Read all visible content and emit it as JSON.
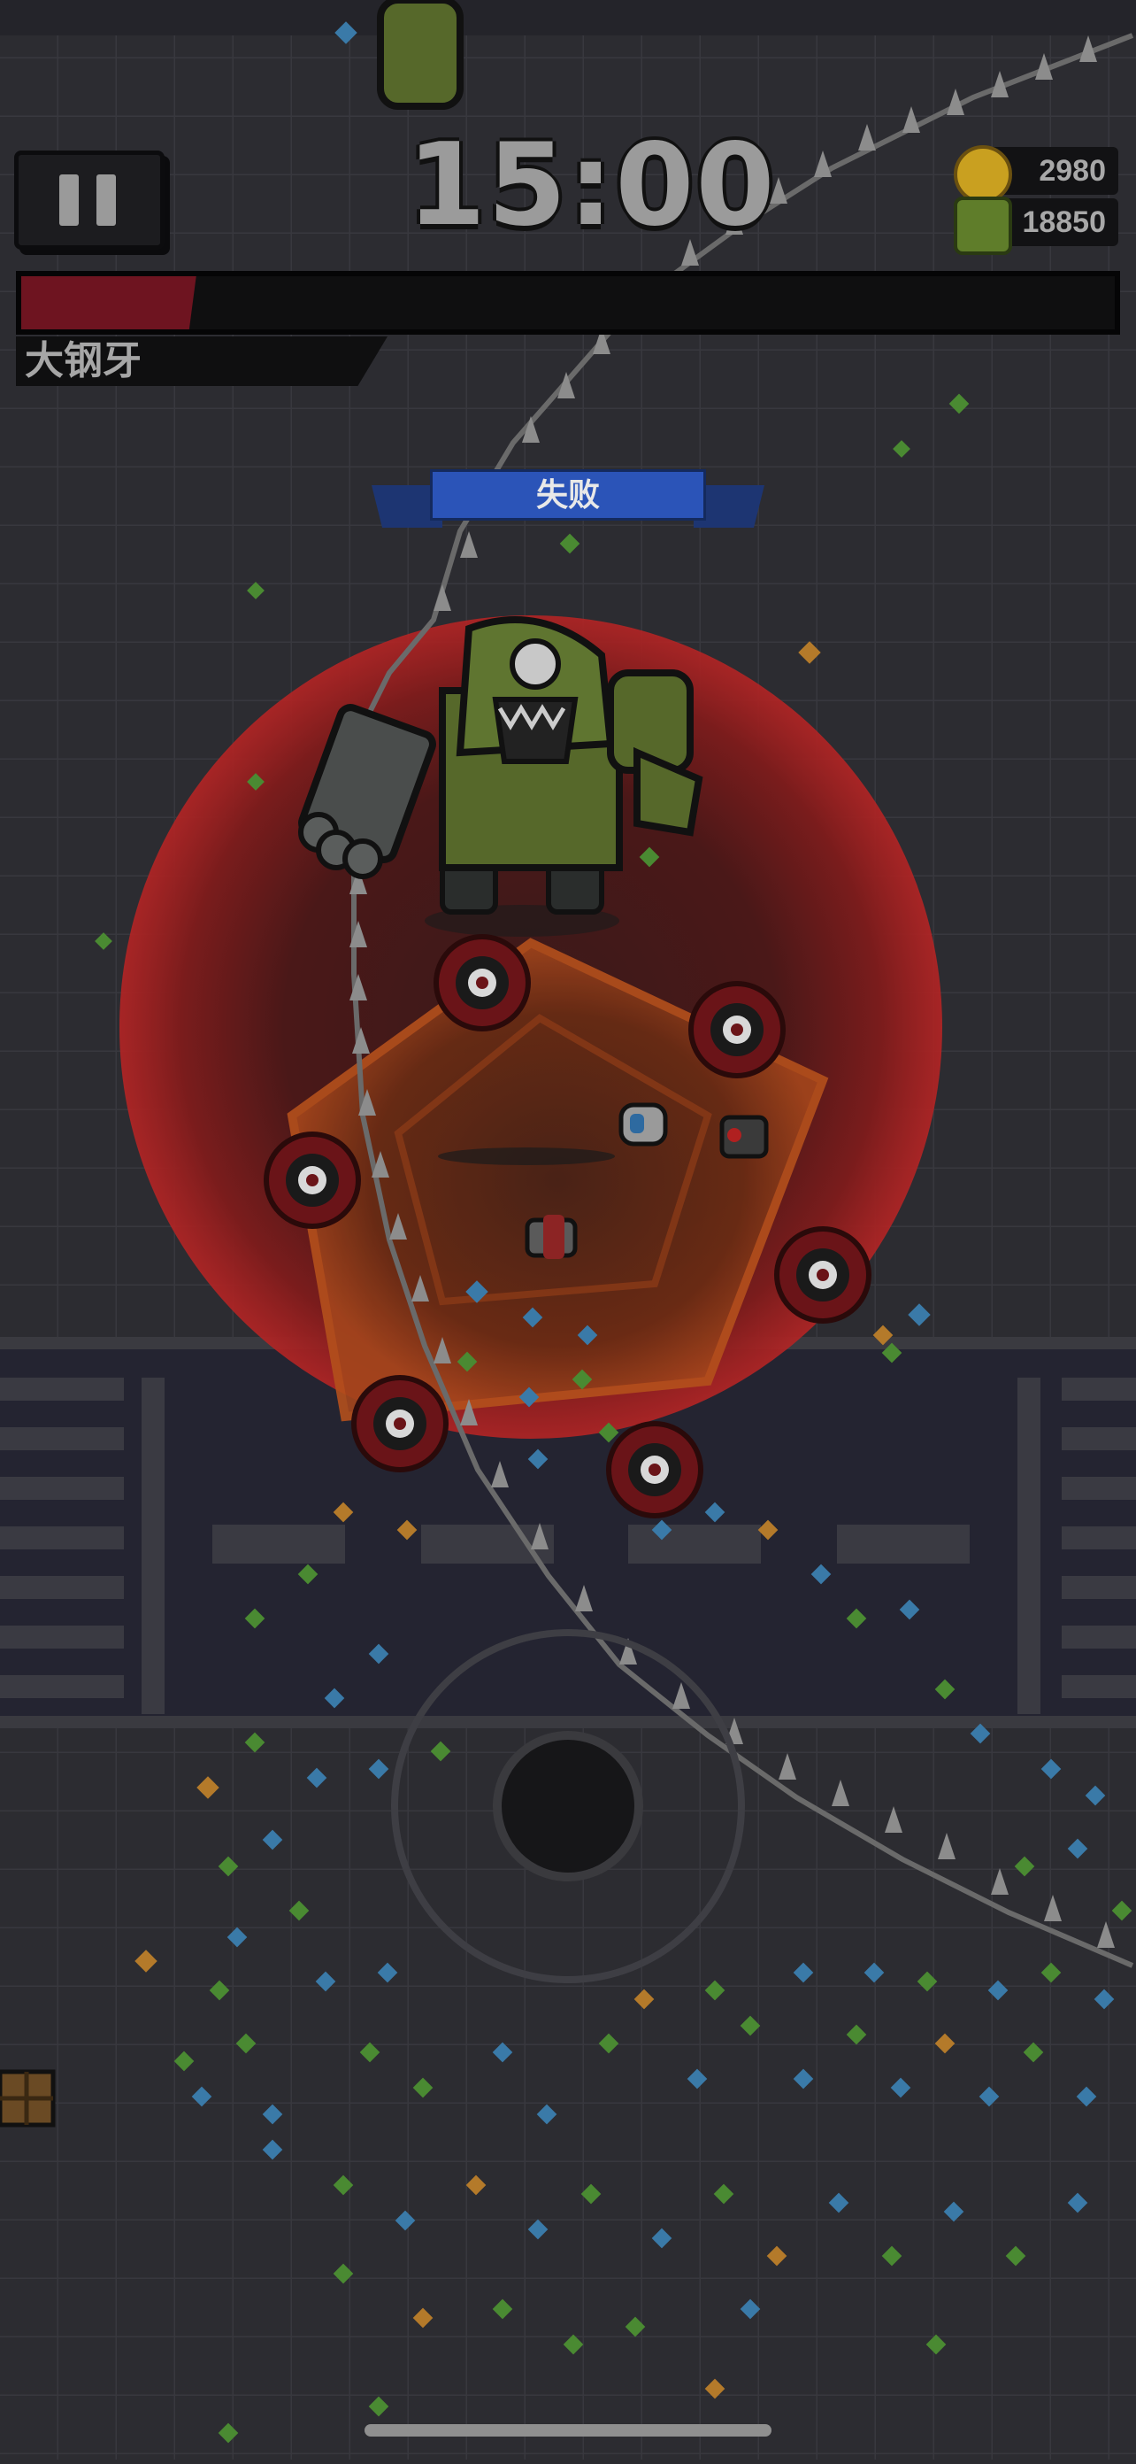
{
  "hud": {
    "timer": "15:00",
    "gold": "2980",
    "kills": "18850",
    "boss_name": "大钢牙",
    "boss_health": 0.16,
    "status_banner": "失败"
  },
  "icons": {
    "pause": "pause-icon",
    "gold": "coin-icon",
    "kills": "skull-icon",
    "joystick": "joystick-icon"
  },
  "colors": {
    "background": "#2b2b30",
    "boss_health": "#6e1420",
    "banner": "#2b54b8",
    "gold": "#c9a020",
    "kills": "#5f7d2a"
  }
}
